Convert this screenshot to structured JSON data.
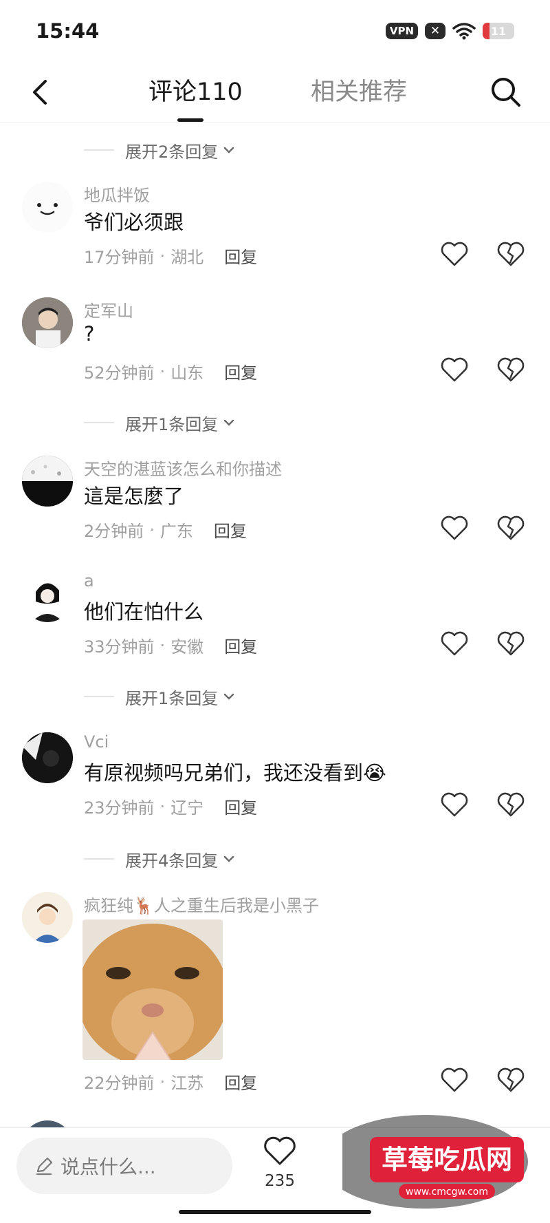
{
  "status": {
    "time": "15:44",
    "vpn": "VPN",
    "x_badge": "✕",
    "battery": "11"
  },
  "nav": {
    "tab_comments": "评论110",
    "tab_related": "相关推荐"
  },
  "expand": {
    "e1": "展开2条回复",
    "e2": "展开1条回复",
    "e3": "展开1条回复",
    "e4": "展开4条回复"
  },
  "comments": [
    {
      "user": "地瓜拌饭",
      "text": "爷们必须跟",
      "time": "17分钟前",
      "loc": "湖北",
      "reply": "回复"
    },
    {
      "user": "定军山",
      "text": "?",
      "time": "52分钟前",
      "loc": "山东",
      "reply": "回复"
    },
    {
      "user": "天空的湛蓝该怎么和你描述",
      "text": "這是怎麼了",
      "time": "2分钟前",
      "loc": "广东",
      "reply": "回复"
    },
    {
      "user": "a",
      "text": "他们在怕什么",
      "time": "33分钟前",
      "loc": "安徽",
      "reply": "回复"
    },
    {
      "user": "Vci",
      "text": "有原视频吗兄弟们，我还没看到😭",
      "time": "23分钟前",
      "loc": "辽宁",
      "reply": "回复"
    },
    {
      "user": "疯狂纯🦌人之重生后我是小黑子",
      "text": "",
      "time": "22分钟前",
      "loc": "江苏",
      "reply": "回复"
    }
  ],
  "bottom": {
    "placeholder": "说点什么...",
    "like_count": "235"
  },
  "watermark": {
    "title": "草莓吃瓜网",
    "url": "www.cmcgw.com"
  },
  "meta_sep": "·"
}
